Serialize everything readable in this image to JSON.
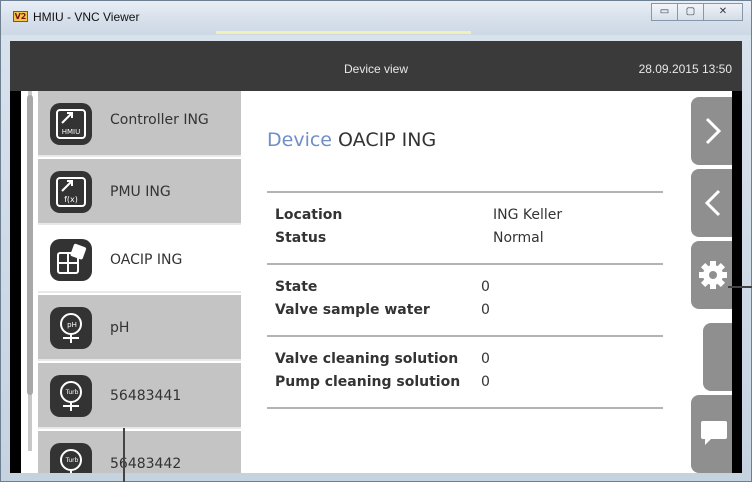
{
  "window": {
    "logo": "V2",
    "title": "HMIU - VNC Viewer",
    "buttons": [
      "▭",
      "▢",
      "✕"
    ]
  },
  "header": {
    "title": "Device view",
    "datetime": "28.09.2015  13:50"
  },
  "sidebar": {
    "items": [
      {
        "label": "Controller ING",
        "icon": "hmiu-controller-icon",
        "icon_text": "HMIU"
      },
      {
        "label": "PMU ING",
        "icon": "pmu-function-icon",
        "icon_text": "f(x)"
      },
      {
        "label": "OACIP ING",
        "icon": "oacip-module-icon",
        "icon_text": ""
      },
      {
        "label": "pH",
        "icon": "ph-sensor-icon",
        "icon_text": "pH"
      },
      {
        "label": "56483441",
        "icon": "turbidity-sensor-icon",
        "icon_text": "Turb"
      },
      {
        "label": "56483442",
        "icon": "turbidity-sensor-icon",
        "icon_text": "Turb"
      }
    ],
    "active_index": 2
  },
  "device": {
    "title_keyword": "Device",
    "title_name": "OACIP ING",
    "groups": [
      [
        {
          "key": "Location",
          "value": "ING Keller"
        },
        {
          "key": "Status",
          "value": "Normal"
        }
      ],
      [
        {
          "key": "State",
          "value": "0"
        },
        {
          "key": "Valve sample water",
          "value": "0"
        }
      ],
      [
        {
          "key": "Valve cleaning solution",
          "value": "0"
        },
        {
          "key": "Pump cleaning solution",
          "value": "0"
        }
      ]
    ]
  },
  "right_buttons": [
    "next-icon",
    "back-icon",
    "settings-gear-icon",
    "blank",
    "chat-message-icon"
  ],
  "colors": {
    "header_bg": "#3a3a3a",
    "sidebar_item_bg": "#c4c4c4",
    "title_keyword": "#6f8fc6",
    "button_bg": "#8f8f8f"
  }
}
